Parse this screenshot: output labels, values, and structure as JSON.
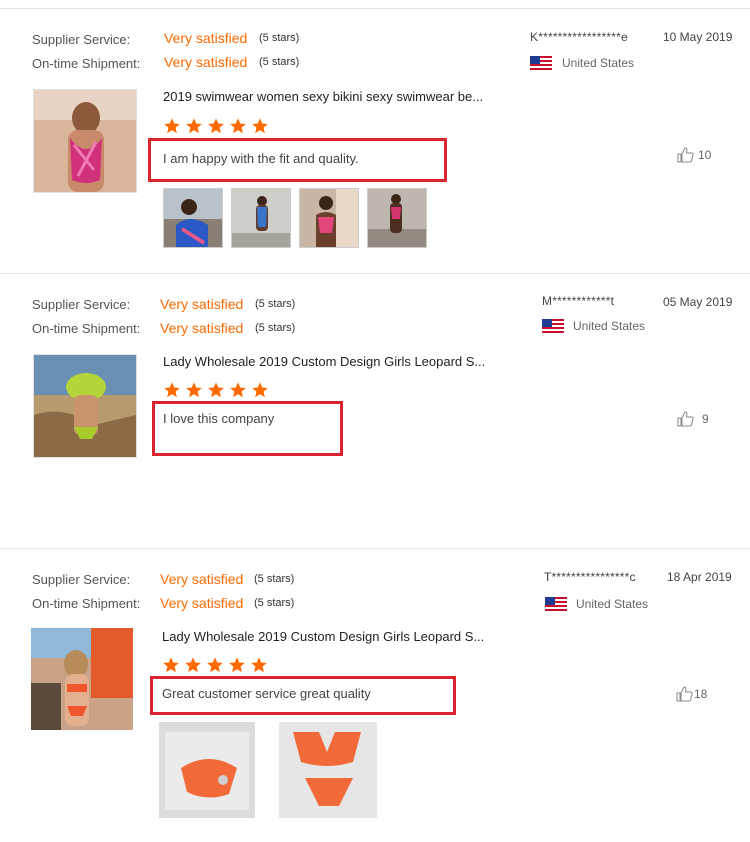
{
  "labels": {
    "supplier_service": "Supplier Service:",
    "on_time_shipment": "On-time Shipment:"
  },
  "reviews": [
    {
      "supplier_rating": "Very satisfied",
      "supplier_stars": "(5 stars)",
      "shipment_rating": "Very satisfied",
      "shipment_stars": "(5 stars)",
      "user": "K*****************e",
      "date": "10 May 2019",
      "country": "United States",
      "product_title": "2019 swimwear women sexy bikini sexy swimwear be...",
      "stars": 5,
      "comment": "I am happy with the fit and  quality.",
      "likes": "10",
      "photos": 4
    },
    {
      "supplier_rating": "Very satisfied",
      "supplier_stars": "(5 stars)",
      "shipment_rating": "Very satisfied",
      "shipment_stars": "(5 stars)",
      "user": "M************t",
      "date": "05 May 2019",
      "country": "United States",
      "product_title": "Lady Wholesale 2019 Custom Design Girls Leopard S...",
      "stars": 5,
      "comment": "I love this company",
      "likes": "9",
      "photos": 0
    },
    {
      "supplier_rating": "Very satisfied",
      "supplier_stars": "(5 stars)",
      "shipment_rating": "Very satisfied",
      "shipment_stars": "(5 stars)",
      "user": "T****************c",
      "date": "18 Apr 2019",
      "country": "United States",
      "product_title": "Lady Wholesale 2019 Custom Design Girls Leopard S...",
      "stars": 5,
      "comment": "Great customer service great quality",
      "likes": "18",
      "photos": 2
    }
  ],
  "colors": {
    "accent": "#ff6a00",
    "highlight": "#d9232e"
  },
  "icons": {
    "star": "star-icon",
    "like": "thumbs-up-icon",
    "flag": "us-flag-icon"
  }
}
